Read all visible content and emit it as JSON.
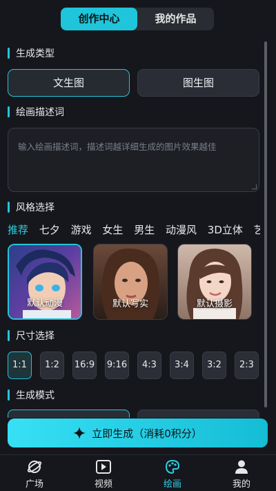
{
  "top_tabs": {
    "create": "创作中心",
    "works": "我的作品"
  },
  "sections": {
    "type": "生成类型",
    "prompt": "绘画描述词",
    "style": "风格选择",
    "size": "尺寸选择",
    "mode": "生成模式"
  },
  "gen_types": [
    "文生图",
    "图生图"
  ],
  "prompt_placeholder": "输入绘画描述词，描述词越详细生成的图片效果越佳",
  "style_tabs": [
    "推荐",
    "七夕",
    "游戏",
    "女生",
    "男生",
    "动漫风",
    "3D立体",
    "艺术"
  ],
  "style_cards": [
    "默认动漫",
    "默认写实",
    "默认摄影"
  ],
  "sizes": [
    "1:1",
    "1:2",
    "16:9",
    "9:16",
    "4:3",
    "3:4",
    "3:2",
    "2:3"
  ],
  "generate_label": "立即生成（消耗0积分）",
  "nav": [
    "广场",
    "视频",
    "绘画",
    "我的"
  ],
  "icons": {
    "nav": [
      "planet-icon",
      "video-play-icon",
      "palette-icon",
      "user-icon"
    ],
    "generate": "sparkle-icon"
  },
  "colors": {
    "accent": "#22c7dd",
    "background": "#16171c",
    "button": "#2a2d35"
  }
}
